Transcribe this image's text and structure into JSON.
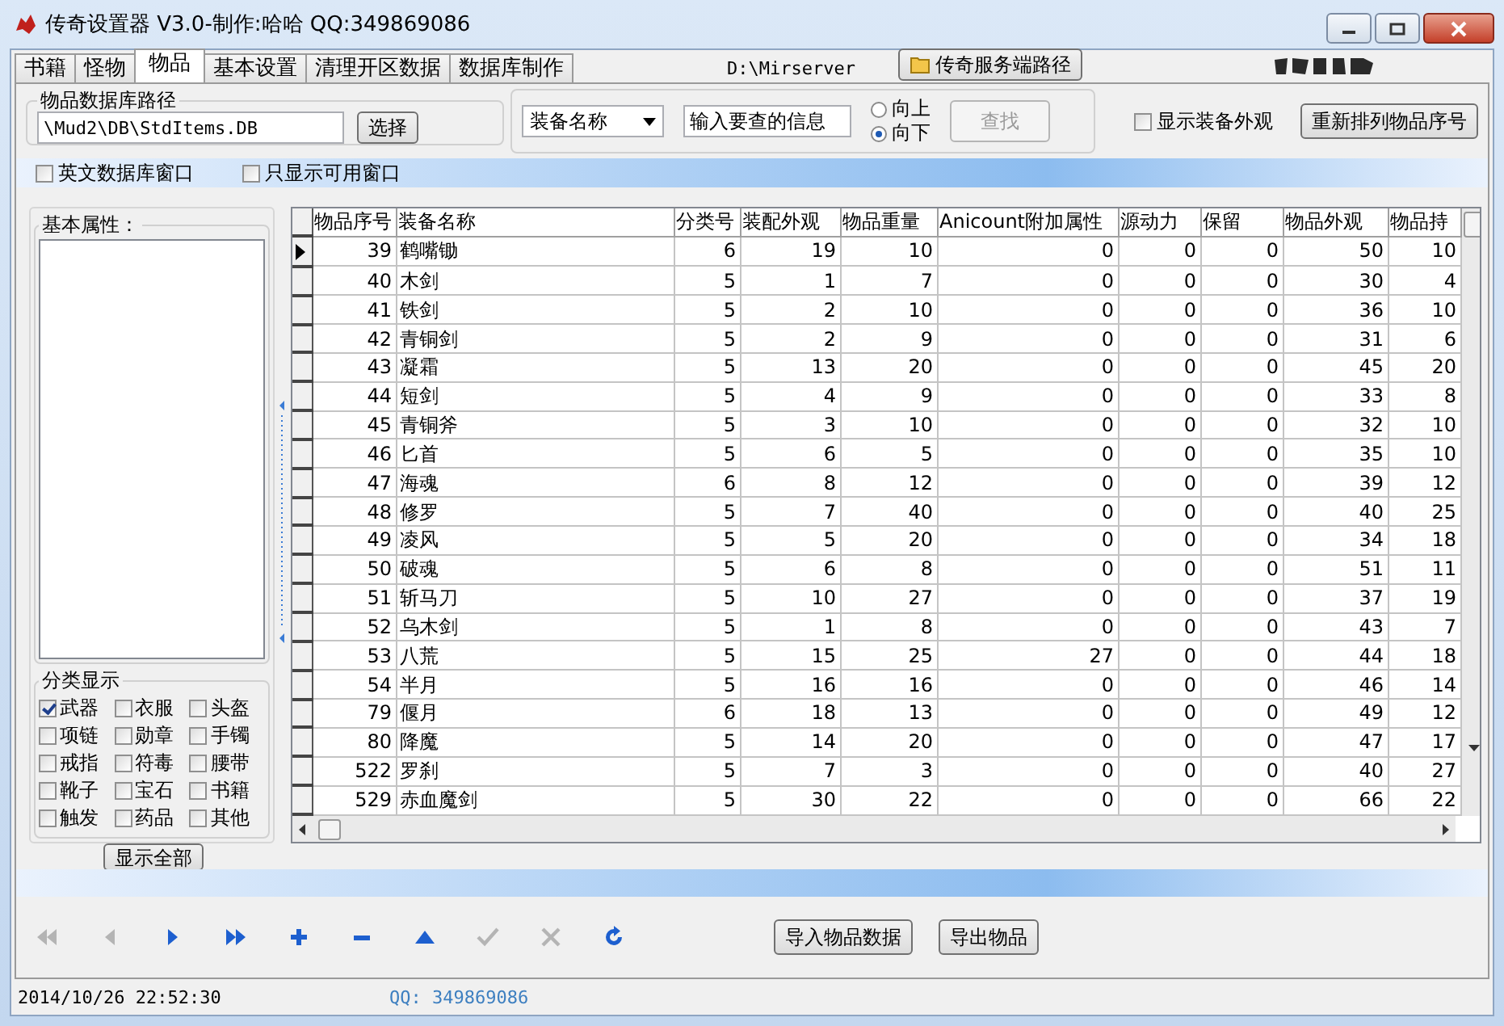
{
  "window": {
    "title": "传奇设置器 V3.0-制作:哈哈 QQ:349869086"
  },
  "tabs": [
    {
      "label": "书籍",
      "selected": false
    },
    {
      "label": "怪物",
      "selected": false
    },
    {
      "label": "物品",
      "selected": true
    },
    {
      "label": "基本设置",
      "selected": false
    },
    {
      "label": "清理开区数据",
      "selected": false
    },
    {
      "label": "数据库制作",
      "selected": false
    }
  ],
  "server_path": {
    "value": "D:\\Mirserver",
    "button": "传奇服务端路径"
  },
  "db_path": {
    "legend": "物品数据库路径",
    "value": "\\Mud2\\DB\\StdItems.DB",
    "button": "选择"
  },
  "search": {
    "field": "装备名称",
    "value": "输入要查的信息",
    "button": "查找",
    "button_disabled": true,
    "directions": [
      {
        "label": "向上",
        "selected": false
      },
      {
        "label": "向下",
        "selected": true
      }
    ]
  },
  "show_appearance": {
    "label": "显示装备外观",
    "checked": false
  },
  "renumber_button": "重新排列物品序号",
  "options": [
    {
      "label": "英文数据库窗口",
      "checked": false
    },
    {
      "label": "只显示可用窗口",
      "checked": false
    }
  ],
  "attributes": {
    "legend": "基本属性："
  },
  "categories": {
    "legend": "分类显示",
    "items": [
      {
        "label": "武器",
        "checked": true
      },
      {
        "label": "衣服",
        "checked": false
      },
      {
        "label": "头盔",
        "checked": false
      },
      {
        "label": "项链",
        "checked": false
      },
      {
        "label": "勋章",
        "checked": false
      },
      {
        "label": "手镯",
        "checked": false
      },
      {
        "label": "戒指",
        "checked": false
      },
      {
        "label": "符毒",
        "checked": false
      },
      {
        "label": "腰带",
        "checked": false
      },
      {
        "label": "靴子",
        "checked": false
      },
      {
        "label": "宝石",
        "checked": false
      },
      {
        "label": "书籍",
        "checked": false
      },
      {
        "label": "触发",
        "checked": false
      },
      {
        "label": "药品",
        "checked": false
      },
      {
        "label": "其他",
        "checked": false
      }
    ]
  },
  "show_all_button": "显示全部",
  "table": {
    "columns": [
      "物品序号",
      "装备名称",
      "分类号",
      "装配外观",
      "物品重量",
      "Anicount附加属性",
      "源动力",
      "保留",
      "物品外观",
      "物品持"
    ],
    "rows": [
      {
        "selected": true,
        "cells": [
          "39",
          "鹤嘴锄",
          "6",
          "19",
          "10",
          "0",
          "0",
          "0",
          "50",
          "10"
        ]
      },
      {
        "selected": false,
        "cells": [
          "40",
          "木剑",
          "5",
          "1",
          "7",
          "0",
          "0",
          "0",
          "30",
          "4"
        ]
      },
      {
        "selected": false,
        "cells": [
          "41",
          "铁剑",
          "5",
          "2",
          "10",
          "0",
          "0",
          "0",
          "36",
          "10"
        ]
      },
      {
        "selected": false,
        "cells": [
          "42",
          "青铜剑",
          "5",
          "2",
          "9",
          "0",
          "0",
          "0",
          "31",
          "6"
        ]
      },
      {
        "selected": false,
        "cells": [
          "43",
          "凝霜",
          "5",
          "13",
          "20",
          "0",
          "0",
          "0",
          "45",
          "20"
        ]
      },
      {
        "selected": false,
        "cells": [
          "44",
          "短剑",
          "5",
          "4",
          "9",
          "0",
          "0",
          "0",
          "33",
          "8"
        ]
      },
      {
        "selected": false,
        "cells": [
          "45",
          "青铜斧",
          "5",
          "3",
          "10",
          "0",
          "0",
          "0",
          "32",
          "10"
        ]
      },
      {
        "selected": false,
        "cells": [
          "46",
          "匕首",
          "5",
          "6",
          "5",
          "0",
          "0",
          "0",
          "35",
          "10"
        ]
      },
      {
        "selected": false,
        "cells": [
          "47",
          "海魂",
          "6",
          "8",
          "12",
          "0",
          "0",
          "0",
          "39",
          "12"
        ]
      },
      {
        "selected": false,
        "cells": [
          "48",
          "修罗",
          "5",
          "7",
          "40",
          "0",
          "0",
          "0",
          "40",
          "25"
        ]
      },
      {
        "selected": false,
        "cells": [
          "49",
          "凌风",
          "5",
          "5",
          "20",
          "0",
          "0",
          "0",
          "34",
          "18"
        ]
      },
      {
        "selected": false,
        "cells": [
          "50",
          "破魂",
          "5",
          "6",
          "8",
          "0",
          "0",
          "0",
          "51",
          "11"
        ]
      },
      {
        "selected": false,
        "cells": [
          "51",
          "斩马刀",
          "5",
          "10",
          "27",
          "0",
          "0",
          "0",
          "37",
          "19"
        ]
      },
      {
        "selected": false,
        "cells": [
          "52",
          "乌木剑",
          "5",
          "1",
          "8",
          "0",
          "0",
          "0",
          "43",
          "7"
        ]
      },
      {
        "selected": false,
        "cells": [
          "53",
          "八荒",
          "5",
          "15",
          "25",
          "27",
          "0",
          "0",
          "44",
          "18"
        ]
      },
      {
        "selected": false,
        "cells": [
          "54",
          "半月",
          "5",
          "16",
          "16",
          "0",
          "0",
          "0",
          "46",
          "14"
        ]
      },
      {
        "selected": false,
        "cells": [
          "79",
          "偃月",
          "6",
          "18",
          "13",
          "0",
          "0",
          "0",
          "49",
          "12"
        ]
      },
      {
        "selected": false,
        "cells": [
          "80",
          "降魔",
          "5",
          "14",
          "20",
          "0",
          "0",
          "0",
          "47",
          "17"
        ]
      },
      {
        "selected": false,
        "cells": [
          "522",
          "罗刹",
          "5",
          "7",
          "3",
          "0",
          "0",
          "0",
          "40",
          "27"
        ]
      },
      {
        "selected": false,
        "cells": [
          "529",
          "赤血魔剑",
          "5",
          "30",
          "22",
          "0",
          "0",
          "0",
          "66",
          "22"
        ]
      }
    ]
  },
  "navigator": [
    {
      "kind": "first",
      "disabled": true
    },
    {
      "kind": "prior",
      "disabled": true
    },
    {
      "kind": "next",
      "disabled": false
    },
    {
      "kind": "last",
      "disabled": false
    },
    {
      "kind": "insert",
      "disabled": false
    },
    {
      "kind": "delete",
      "disabled": false
    },
    {
      "kind": "edit",
      "disabled": false
    },
    {
      "kind": "post",
      "disabled": true
    },
    {
      "kind": "cancel",
      "disabled": true
    },
    {
      "kind": "refresh",
      "disabled": false
    }
  ],
  "action_buttons": [
    "导入物品数据",
    "导出物品"
  ],
  "status_bar": {
    "time": "2014/10/26 22:52:30",
    "qq": "QQ: 349869086"
  }
}
